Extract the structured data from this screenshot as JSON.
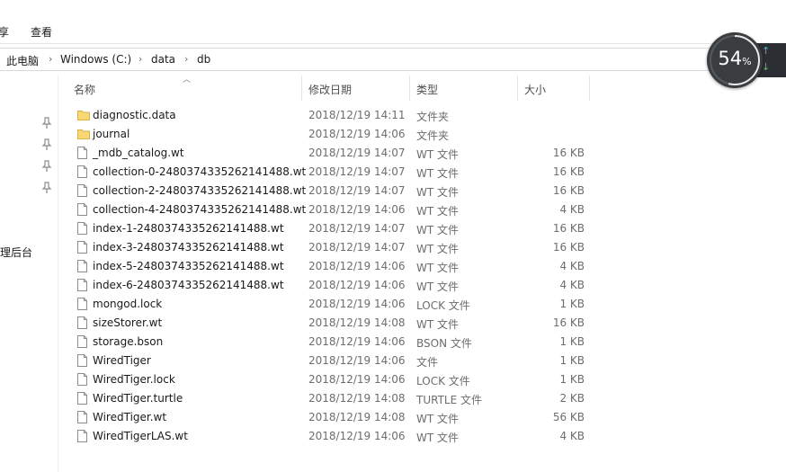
{
  "ribbon": {
    "tab_share_fragment": "享",
    "tab_view": "查看"
  },
  "address": {
    "crumbs": [
      "此电脑",
      "Windows (C:)",
      "data",
      "db"
    ]
  },
  "nav": {
    "label": "理后台"
  },
  "columns": {
    "name": "名称",
    "date": "修改日期",
    "type": "类型",
    "size": "大小"
  },
  "files": [
    {
      "name": "diagnostic.data",
      "date": "2018/12/19 14:11",
      "type": "文件夹",
      "size": "",
      "icon": "folder-icon"
    },
    {
      "name": "journal",
      "date": "2018/12/19 14:06",
      "type": "文件夹",
      "size": "",
      "icon": "folder-icon"
    },
    {
      "name": "_mdb_catalog.wt",
      "date": "2018/12/19 14:07",
      "type": "WT 文件",
      "size": "16 KB",
      "icon": "file-icon"
    },
    {
      "name": "collection-0-2480374335262141488.wt",
      "date": "2018/12/19 14:07",
      "type": "WT 文件",
      "size": "16 KB",
      "icon": "file-icon"
    },
    {
      "name": "collection-2-2480374335262141488.wt",
      "date": "2018/12/19 14:07",
      "type": "WT 文件",
      "size": "16 KB",
      "icon": "file-icon"
    },
    {
      "name": "collection-4-2480374335262141488.wt",
      "date": "2018/12/19 14:06",
      "type": "WT 文件",
      "size": "4 KB",
      "icon": "file-icon"
    },
    {
      "name": "index-1-2480374335262141488.wt",
      "date": "2018/12/19 14:07",
      "type": "WT 文件",
      "size": "16 KB",
      "icon": "file-icon"
    },
    {
      "name": "index-3-2480374335262141488.wt",
      "date": "2018/12/19 14:07",
      "type": "WT 文件",
      "size": "16 KB",
      "icon": "file-icon"
    },
    {
      "name": "index-5-2480374335262141488.wt",
      "date": "2018/12/19 14:06",
      "type": "WT 文件",
      "size": "4 KB",
      "icon": "file-icon"
    },
    {
      "name": "index-6-2480374335262141488.wt",
      "date": "2018/12/19 14:06",
      "type": "WT 文件",
      "size": "4 KB",
      "icon": "file-icon"
    },
    {
      "name": "mongod.lock",
      "date": "2018/12/19 14:06",
      "type": "LOCK 文件",
      "size": "1 KB",
      "icon": "file-icon"
    },
    {
      "name": "sizeStorer.wt",
      "date": "2018/12/19 14:08",
      "type": "WT 文件",
      "size": "16 KB",
      "icon": "file-icon"
    },
    {
      "name": "storage.bson",
      "date": "2018/12/19 14:06",
      "type": "BSON 文件",
      "size": "1 KB",
      "icon": "file-icon"
    },
    {
      "name": "WiredTiger",
      "date": "2018/12/19 14:06",
      "type": "文件",
      "size": "1 KB",
      "icon": "file-icon"
    },
    {
      "name": "WiredTiger.lock",
      "date": "2018/12/19 14:06",
      "type": "LOCK 文件",
      "size": "1 KB",
      "icon": "file-icon"
    },
    {
      "name": "WiredTiger.turtle",
      "date": "2018/12/19 14:08",
      "type": "TURTLE 文件",
      "size": "2 KB",
      "icon": "file-icon"
    },
    {
      "name": "WiredTiger.wt",
      "date": "2018/12/19 14:08",
      "type": "WT 文件",
      "size": "56 KB",
      "icon": "file-icon"
    },
    {
      "name": "WiredTigerLAS.wt",
      "date": "2018/12/19 14:06",
      "type": "WT 文件",
      "size": "4 KB",
      "icon": "file-icon"
    }
  ],
  "widget": {
    "percent": "54",
    "unit": "%",
    "level": 0.54
  },
  "colors": {
    "folder": "#f8d775",
    "gauge_arc": "#e8e8e8",
    "up_arrow": "#3fb3e8",
    "down_arrow": "#4cc04c"
  }
}
